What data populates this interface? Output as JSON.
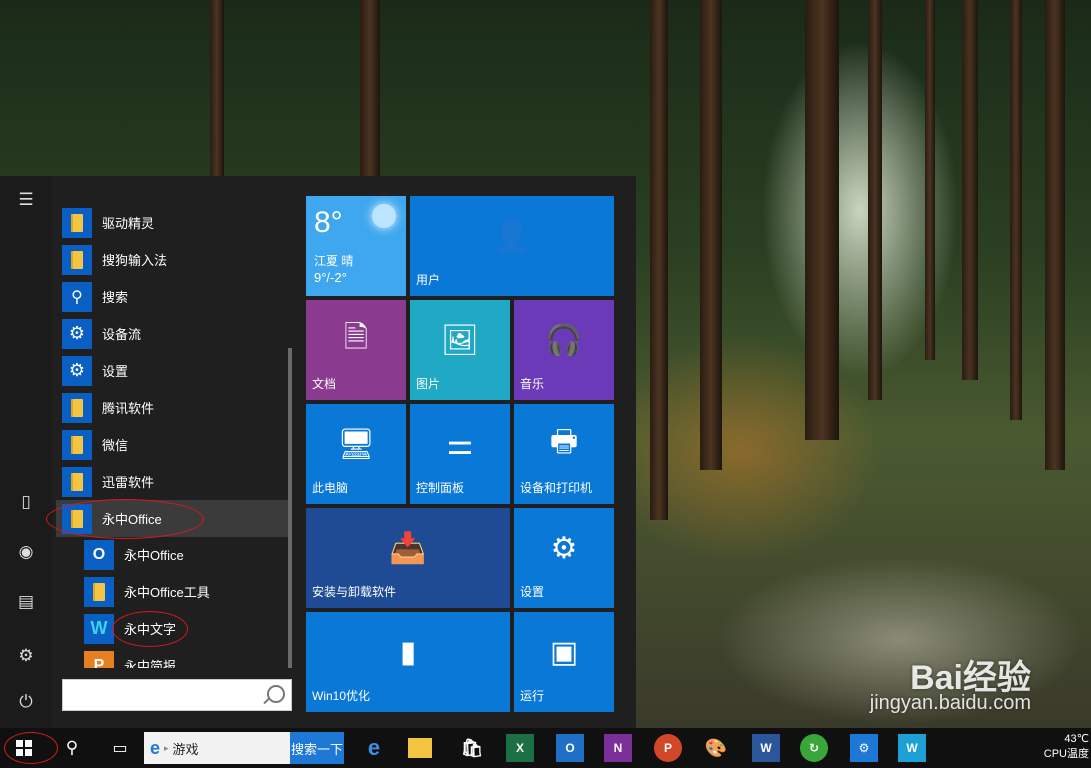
{
  "start_menu": {
    "apps": [
      {
        "label": "驱动精灵",
        "icon": "folder-icon"
      },
      {
        "label": "搜狗输入法",
        "icon": "folder-icon"
      },
      {
        "label": "搜索",
        "icon": "search-app-icon"
      },
      {
        "label": "设备流",
        "icon": "gear-icon"
      },
      {
        "label": "设置",
        "icon": "gear-icon"
      },
      {
        "label": "腾讯软件",
        "icon": "folder-icon"
      },
      {
        "label": "微信",
        "icon": "folder-icon"
      },
      {
        "label": "迅雷软件",
        "icon": "folder-icon"
      },
      {
        "label": "永中Office",
        "icon": "folder-icon",
        "expanded": true
      },
      {
        "label": "永中Office",
        "icon": "yozo-office-icon",
        "sub": true
      },
      {
        "label": "永中Office工具",
        "icon": "folder-icon",
        "sub": true
      },
      {
        "label": "永中文字",
        "icon": "yozo-word-icon",
        "sub": true
      },
      {
        "label": "永中简报",
        "icon": "yozo-slides-icon",
        "sub": true
      }
    ],
    "search_placeholder": ""
  },
  "tiles": {
    "weather": {
      "temp": "8°",
      "location": "江夏 晴",
      "range": "9°/-2°"
    },
    "user": "用户",
    "documents": "文档",
    "pictures": "图片",
    "music": "音乐",
    "this_pc": "此电脑",
    "control_panel": "控制面板",
    "devices_printers": "设备和打印机",
    "install_uninstall": "安装与卸载软件",
    "settings": "设置",
    "win10": "Win10优化",
    "run": "运行"
  },
  "taskbar": {
    "search_text": "游戏",
    "search_button": "搜索一下",
    "tray_temp": "43℃",
    "tray_label": "CPU温度"
  },
  "watermark": {
    "brand": "Bai经验",
    "url": "jingyan.baidu.com"
  },
  "colors": {
    "tile_blue": "#0a78d7",
    "tile_purple": "#8a3a8f",
    "tile_teal": "#20a9c4",
    "tile_violet": "#6b3ab8",
    "tile_navy": "#1f4b94",
    "accent": "#0078d7"
  }
}
